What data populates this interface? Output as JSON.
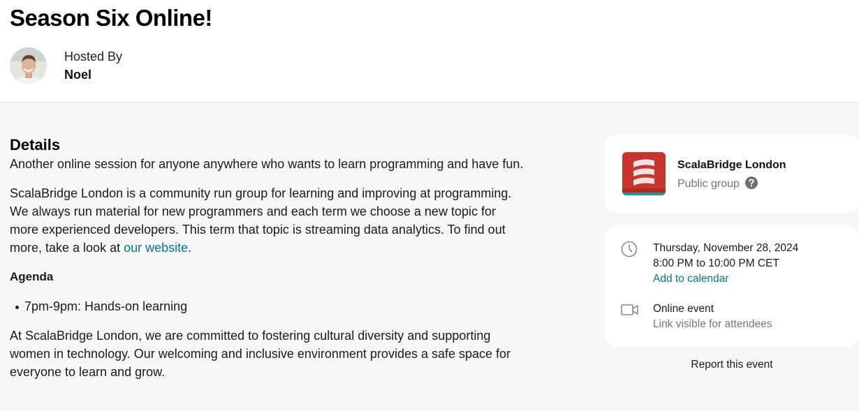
{
  "event": {
    "title": "Season Six Online!",
    "hosted_by_label": "Hosted By",
    "host_name": "Noel"
  },
  "details": {
    "heading": "Details",
    "paragraph1": "Another online session for anyone anywhere who wants to learn programming and have fun.",
    "paragraph2_text": "ScalaBridge London is a community run group for learning and improving at programming. We always run material for new programmers and each term we choose a new topic for more experienced developers. This term that topic is streaming data analytics. To find out more, take a look at ",
    "paragraph2_link": "our website",
    "paragraph2_end": ".",
    "agenda_heading": "Agenda",
    "agenda_items": [
      "7pm-9pm: Hands-on learning"
    ],
    "paragraph3": "At ScalaBridge London, we are committed to fostering cultural diversity and supporting women in technology. Our welcoming and inclusive environment provides a safe space for everyone to learn and grow."
  },
  "group": {
    "name": "ScalaBridge London",
    "type": "Public group",
    "logo_icon": "scala-logo-icon",
    "help_icon": "question-circle-icon"
  },
  "schedule": {
    "date": "Thursday, November 28, 2024",
    "time": "8:00 PM to 10:00 PM CET",
    "add_to_calendar": "Add to calendar",
    "location_type": "Online event",
    "location_note": "Link visible for attendees",
    "clock_icon": "clock-icon",
    "video_icon": "video-camera-icon"
  },
  "footer": {
    "report_label": "Report this event"
  },
  "colors": {
    "link": "#00798a",
    "background": "#f6f7f8",
    "card": "#ffffff",
    "logo_red": "#c6362f"
  }
}
